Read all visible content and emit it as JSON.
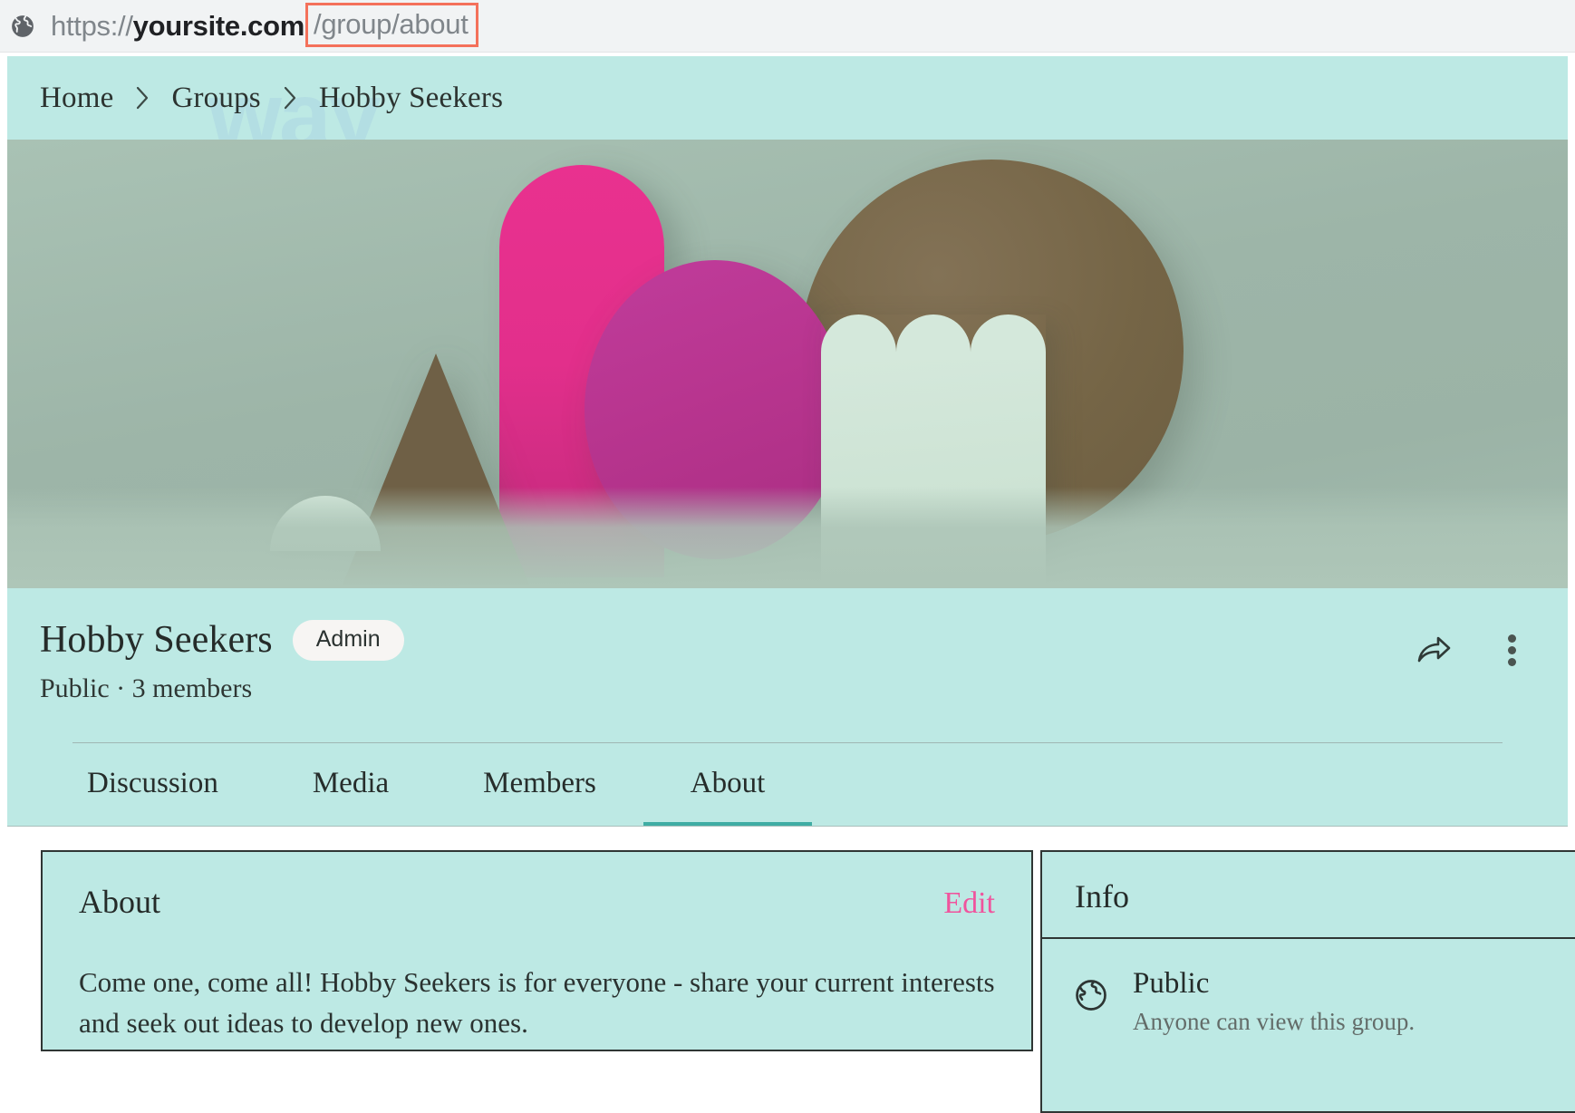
{
  "browser": {
    "favicon_icon": "globe-icon",
    "url_scheme": "https://",
    "url_host": "yoursite.com",
    "url_path": "/group/about",
    "highlight_color": "#f4715b"
  },
  "watermark": {
    "text": "way"
  },
  "breadcrumb": {
    "items": [
      {
        "label": "Home"
      },
      {
        "label": "Groups"
      },
      {
        "label": "Hobby Seekers"
      }
    ],
    "separator": "›"
  },
  "hero": {
    "alt": "abstract paper shapes cover photo",
    "background_color": "#9db5a8",
    "shapes": [
      {
        "name": "pink-pill",
        "color": "#e22f8b"
      },
      {
        "name": "brown-circle",
        "color": "#756546"
      },
      {
        "name": "magenta-circle",
        "color": "#b8358f"
      },
      {
        "name": "brown-triangle",
        "color": "#6f6046"
      },
      {
        "name": "mint-halfdome",
        "color": "#cbe1d4"
      },
      {
        "name": "mint-scallop",
        "color": "#d4e8db"
      }
    ]
  },
  "group": {
    "name": "Hobby Seekers",
    "role_badge": "Admin",
    "privacy": "Public",
    "member_count": "3 members",
    "meta": "Public · 3 members",
    "share_icon": "share-arrow-icon",
    "menu_icon": "more-vertical-icon"
  },
  "tabs": [
    {
      "label": "Discussion",
      "active": false
    },
    {
      "label": "Media",
      "active": false
    },
    {
      "label": "Members",
      "active": false
    },
    {
      "label": "About",
      "active": true
    }
  ],
  "about_card": {
    "title": "About",
    "edit_label": "Edit",
    "body": "Come one, come all! Hobby Seekers is for everyone - share your current interests and seek out ideas to develop new ones."
  },
  "info_card": {
    "title": "Info",
    "rows": [
      {
        "icon": "globe-icon",
        "title": "Public",
        "subtitle": "Anyone can view this group."
      }
    ]
  },
  "colors": {
    "teal_surface": "#bde9e4",
    "accent_pink": "#f0549d",
    "tab_underline": "#3fada4",
    "border_dark": "#2f3634"
  }
}
